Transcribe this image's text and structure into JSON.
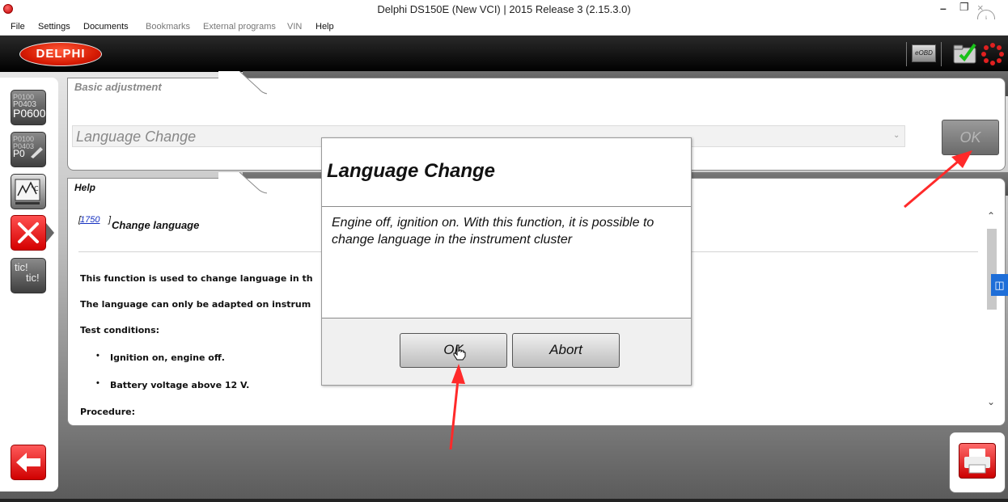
{
  "window": {
    "title": "Delphi DS150E (New VCI) | 2015 Release 3 (2.15.3.0)",
    "controls": {
      "minimize": "–",
      "maximize": "❐",
      "close": "×"
    },
    "info_glyph": "i"
  },
  "menu": {
    "items": [
      {
        "label": "File",
        "enabled": true
      },
      {
        "label": "Settings",
        "enabled": true
      },
      {
        "label": "Documents",
        "enabled": true
      },
      {
        "label": "Bookmarks",
        "enabled": false
      },
      {
        "label": "External programs",
        "enabled": false
      },
      {
        "label": "VIN",
        "enabled": false
      },
      {
        "label": "Help",
        "enabled": true
      }
    ]
  },
  "header": {
    "logo": "DELPHI",
    "eobd_label": "eOBD"
  },
  "sidebar": {
    "dtc_codes": [
      "P0100",
      "P0403",
      "P0600"
    ],
    "dtc_clear_codes": [
      "P0100",
      "P0403",
      "P0"
    ],
    "tic_label": "tic!",
    "tic_label2": "tic!"
  },
  "adjustment": {
    "tab_title": "Basic adjustment",
    "selected_function": "Language Change",
    "ok_label": "OK"
  },
  "help": {
    "tab_title": "Help",
    "ref_number": "1750",
    "heading": "Change language",
    "lines": [
      "This function is used to change language in th",
      "The language can only be adapted on instrum",
      "Test conditions:"
    ],
    "bullets": [
      "Ignition on, engine off.",
      "Battery voltage above 12 V."
    ],
    "procedure_label": "Procedure:"
  },
  "dialog": {
    "title": "Language Change",
    "body": "Engine off, ignition on. With this function, it is possible to change language in the instrument cluster",
    "ok_label": "OK",
    "abort_label": "Abort"
  },
  "colors": {
    "accent_red": "#d40000",
    "annotation_arrow": "#ff2a2a",
    "side_badge": "#1e6ed8"
  }
}
